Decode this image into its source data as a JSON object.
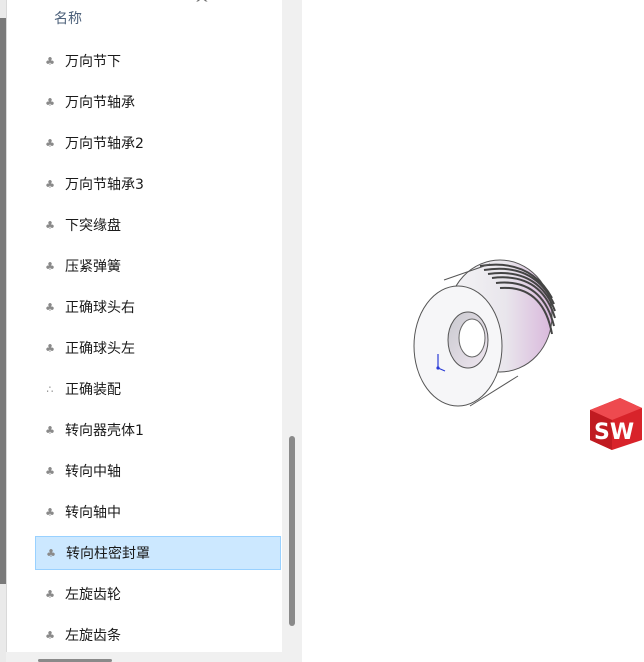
{
  "header": {
    "column_name": "名称",
    "sort_indicator": "^"
  },
  "files": [
    {
      "label": "万向节下",
      "icon": "part-icon",
      "selected": false
    },
    {
      "label": "万向节轴承",
      "icon": "part-icon",
      "selected": false
    },
    {
      "label": "万向节轴承2",
      "icon": "part-icon",
      "selected": false
    },
    {
      "label": "万向节轴承3",
      "icon": "part-icon",
      "selected": false
    },
    {
      "label": "下突缘盘",
      "icon": "part-icon",
      "selected": false
    },
    {
      "label": "压紧弹簧",
      "icon": "part-icon",
      "selected": false
    },
    {
      "label": "正确球头右",
      "icon": "part-icon",
      "selected": false
    },
    {
      "label": "正确球头左",
      "icon": "part-icon",
      "selected": false
    },
    {
      "label": "正确装配",
      "icon": "assembly-icon",
      "selected": false
    },
    {
      "label": "转向器壳体1",
      "icon": "part-icon",
      "selected": false
    },
    {
      "label": "转向中轴",
      "icon": "part-icon",
      "selected": false
    },
    {
      "label": "转向轴中",
      "icon": "part-icon",
      "selected": false
    },
    {
      "label": "转向柱密封罩",
      "icon": "part-icon",
      "selected": true
    },
    {
      "label": "左旋齿轮",
      "icon": "part-icon",
      "selected": false
    },
    {
      "label": "左旋齿条",
      "icon": "part-icon",
      "selected": false
    }
  ],
  "preview": {
    "logo_text": "SW",
    "brand_color": "#d8232a"
  }
}
